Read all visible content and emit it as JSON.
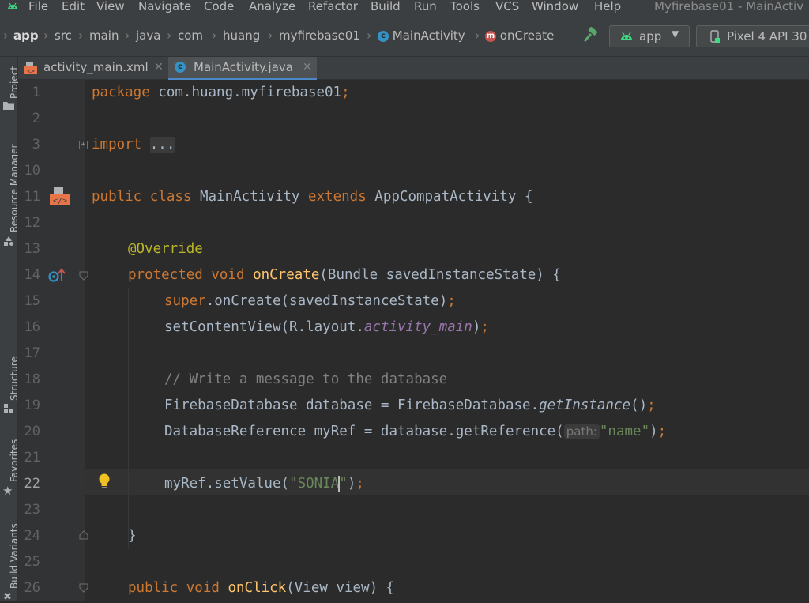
{
  "menu": {
    "items": [
      "File",
      "Edit",
      "View",
      "Navigate",
      "Code",
      "Analyze",
      "Refactor",
      "Build",
      "Run",
      "Tools",
      "VCS",
      "Window",
      "Help"
    ],
    "window_title": "Myfirebase01 - MainActiv"
  },
  "breadcrumb": {
    "items": [
      "app",
      "src",
      "main",
      "java",
      "com",
      "huang",
      "myfirebase01",
      "MainActivity",
      "onCreate"
    ]
  },
  "toolbar": {
    "run_config": "app",
    "device": "Pixel 4 API 30"
  },
  "tool_windows": {
    "project": "Project",
    "resource_manager": "Resource Manager",
    "structure": "Structure",
    "favorites": "Favorites",
    "build_variants": "Build Variants"
  },
  "tabs": [
    {
      "label": "activity_main.xml"
    },
    {
      "label": "MainActivity.java"
    }
  ],
  "editor": {
    "line_numbers": [
      "1",
      "2",
      "3",
      "10",
      "11",
      "12",
      "13",
      "14",
      "15",
      "16",
      "17",
      "18",
      "19",
      "20",
      "21",
      "22",
      "23",
      "24",
      "25",
      "26"
    ],
    "current_line": "22",
    "text": {
      "package_kw": "package",
      "package_name": " com.huang.myfirebase01",
      "semi": ";",
      "import_kw": "import",
      "import_fold": "...",
      "public": "public",
      "class": "class",
      "class_name": "MainActivity",
      "extends": "extends",
      "super_class": "AppCompatActivity {",
      "override": "@Override",
      "protected": "protected",
      "void": "void",
      "oncreate": "onCreate",
      "oncreate_params": "(Bundle savedInstanceState) {",
      "super": "super",
      "super_call": ".onCreate(savedInstanceState)",
      "setcontent": "setContentView(R.layout.",
      "layout_field": "activity_main",
      "close_paren": ")",
      "comment": "// Write a message to the database",
      "db_decl": "FirebaseDatabase database = FirebaseDatabase.",
      "get_instance": "getInstance",
      "call_empty": "()",
      "ref_decl": "DatabaseReference myRef = database.getReference(",
      "hint_path": "path:",
      "str_name": "\"name\"",
      "setvalue": "myRef.setValue(",
      "str_sonia_before": "\"SONIA",
      "str_sonia_after": "\"",
      "close_brace": "}",
      "onclick": "onClick",
      "onclick_params": "(View view) {"
    }
  }
}
